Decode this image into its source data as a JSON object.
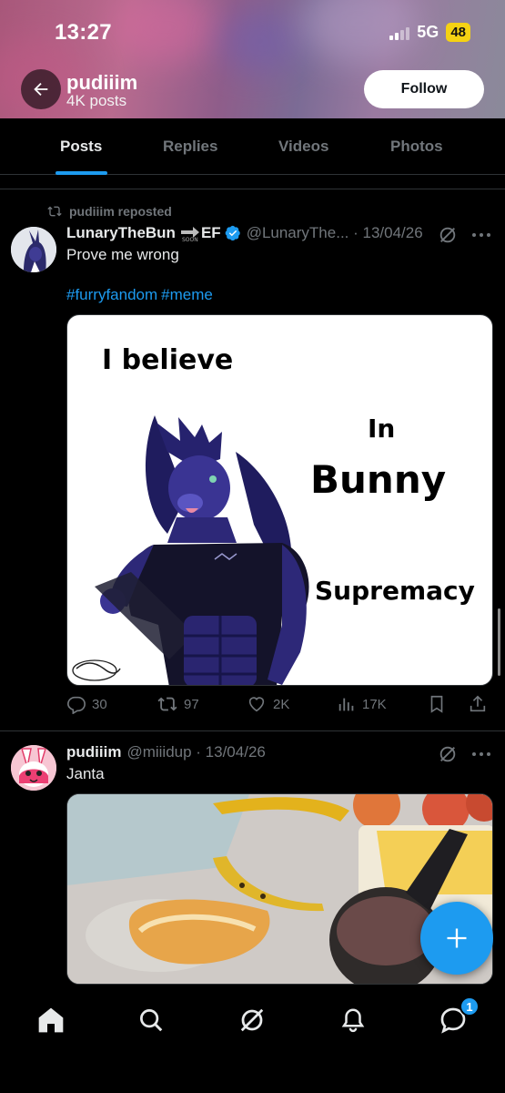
{
  "status_bar": {
    "time": "13:27",
    "network": "5G",
    "battery": "48"
  },
  "profile": {
    "name": "pudiiim",
    "posts_count": "4K posts",
    "follow_label": "Follow"
  },
  "tabs": [
    {
      "label": "Posts",
      "active": true
    },
    {
      "label": "Replies",
      "active": false
    },
    {
      "label": "Videos",
      "active": false
    },
    {
      "label": "Photos",
      "active": false
    }
  ],
  "posts": [
    {
      "repost_label": "pudiiim reposted",
      "author": "LunaryTheBun",
      "author_suffix": "EF",
      "handle_date": "@LunaryThe... · 13/04/26",
      "text": "Prove me wrong",
      "hashtags": [
        "#furryfandom",
        "#meme"
      ],
      "image_text": [
        "I believe",
        "In",
        "Bunny",
        "Supremacy"
      ],
      "stats": {
        "replies": "30",
        "reposts": "97",
        "likes": "2K",
        "views": "17K"
      }
    },
    {
      "author": "pudiiim",
      "handle_date": "@miiidup · 13/04/26",
      "text": "Janta"
    }
  ],
  "nav": {
    "messages_badge": "1"
  },
  "colors": {
    "accent": "#1d9bf0",
    "muted": "#71767b",
    "background": "#000000"
  }
}
